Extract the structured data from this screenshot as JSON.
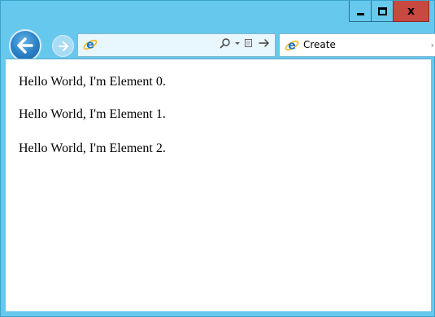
{
  "window": {
    "controls": {
      "minimize_icon": "minimize-icon",
      "maximize_icon": "maximize-icon",
      "close_label": "x"
    }
  },
  "toolbar": {
    "back_icon": "back-arrow-icon",
    "forward_icon": "forward-arrow-icon",
    "address_value": "",
    "search_icon": "search-icon",
    "dropdown_icon": "dropdown-arrow-icon",
    "compat_icon": "compatibility-view-icon",
    "go_icon": "go-arrow-icon"
  },
  "tab": {
    "label": "Create",
    "favicon": "ie-icon",
    "scroll_glyph": "›"
  },
  "content": {
    "lines": [
      "Hello World, I'm Element 0.",
      "Hello World, I'm Element 1.",
      "Hello World, I'm Element 2."
    ]
  },
  "colors": {
    "frame": "#66c8ec",
    "close_button": "#c7493f",
    "back_button": "#2a7fc4",
    "address_bg": "#e8f6fd"
  }
}
